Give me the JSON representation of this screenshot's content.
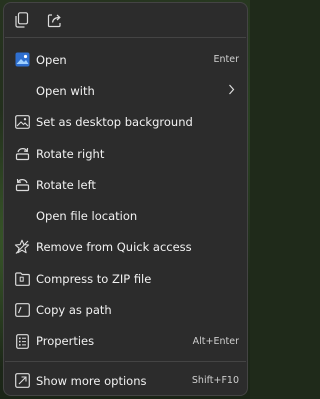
{
  "top_icons": [
    "copy-icon",
    "share-icon"
  ],
  "items": [
    {
      "label": "Open",
      "shortcut": "Enter",
      "icon": "photos-app-icon"
    },
    {
      "label": "Open with",
      "shortcut": "",
      "icon": "none"
    },
    {
      "label": "Set as desktop background",
      "shortcut": "",
      "icon": "desktop-background-icon"
    },
    {
      "label": "Rotate right",
      "shortcut": "",
      "icon": "rotate-right-icon"
    },
    {
      "label": "Rotate left",
      "shortcut": "",
      "icon": "rotate-left-icon"
    },
    {
      "label": "Open file location",
      "shortcut": "",
      "icon": "none"
    },
    {
      "label": "Remove from Quick access",
      "shortcut": "",
      "icon": "star-icon"
    },
    {
      "label": "Compress to ZIP file",
      "shortcut": "",
      "icon": "zip-folder-icon"
    },
    {
      "label": "Copy as path",
      "shortcut": "",
      "icon": "copy-path-icon"
    },
    {
      "label": "Properties",
      "shortcut": "Alt+Enter",
      "icon": "properties-icon"
    }
  ],
  "footer_item": {
    "label": "Show more options",
    "shortcut": "Shift+F10",
    "icon": "show-more-icon"
  },
  "colors": {
    "menu_bg": "#2c2c2c",
    "text": "#f2f2f2",
    "accent": "#3b7fd9"
  }
}
